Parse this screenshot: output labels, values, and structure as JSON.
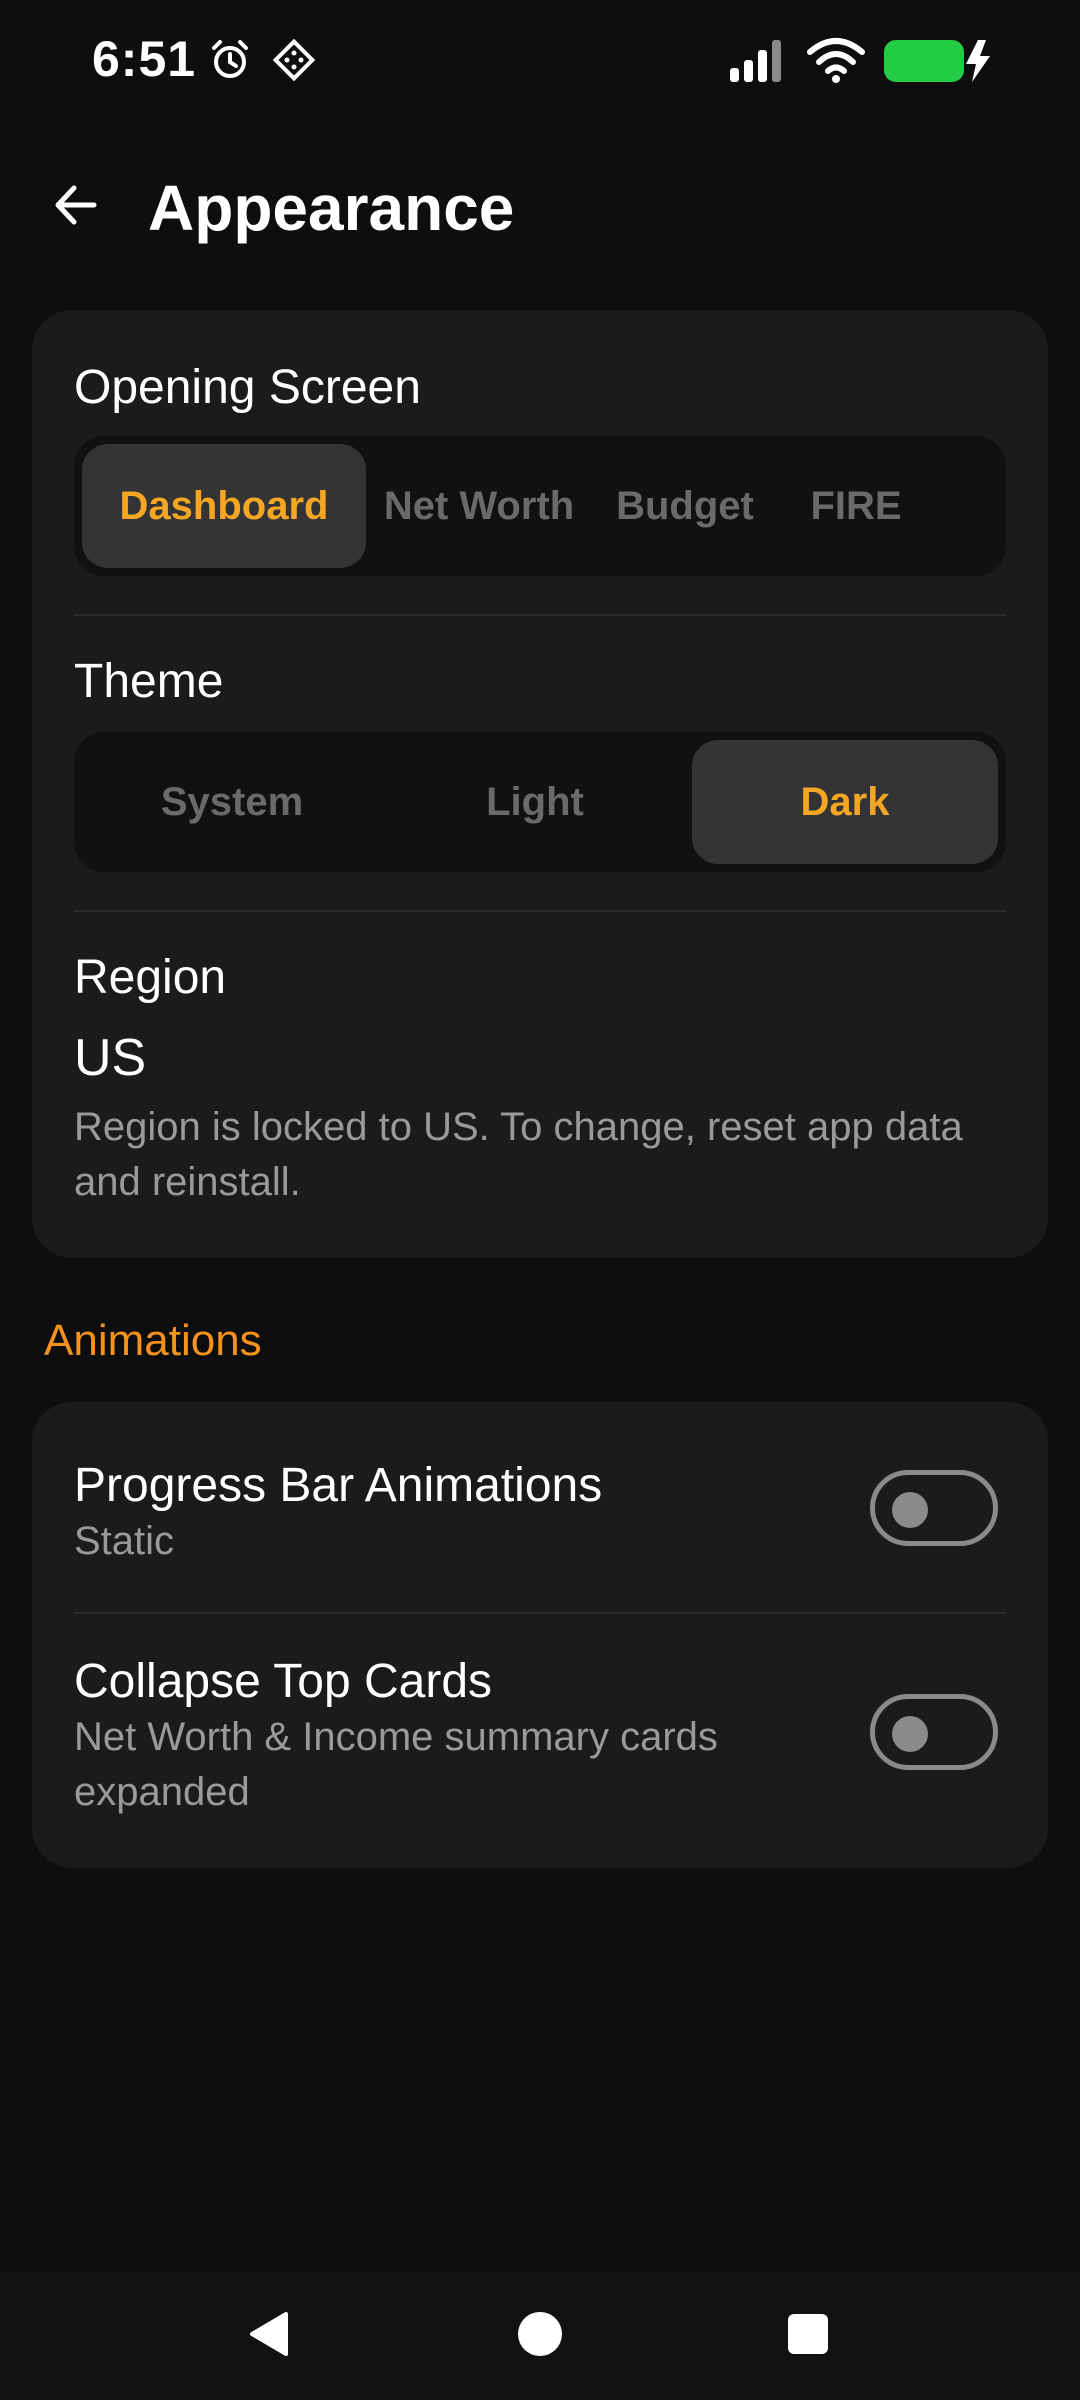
{
  "status_bar": {
    "time": "6:51",
    "icons": [
      "alarm-icon",
      "system-app-icon",
      "signal-icon",
      "wifi-icon",
      "battery-charging-icon"
    ],
    "battery_color": "#22cc44"
  },
  "header": {
    "title": "Appearance",
    "back_icon": "arrow-left-icon"
  },
  "appearance": {
    "opening_screen": {
      "label": "Opening Screen",
      "options": [
        "Dashboard",
        "Net Worth",
        "Budget",
        "FIRE"
      ],
      "selected": "Dashboard"
    },
    "theme": {
      "label": "Theme",
      "options": [
        "System",
        "Light",
        "Dark"
      ],
      "selected": "Dark"
    },
    "region": {
      "label": "Region",
      "value": "US",
      "note": "Region is locked to US. To change, reset app data and reinstall."
    }
  },
  "animations": {
    "heading": "Animations",
    "rows": [
      {
        "title": "Progress Bar Animations",
        "subtitle": "Static",
        "enabled": false
      },
      {
        "title": "Collapse Top Cards",
        "subtitle": "Net Worth & Income summary cards expanded",
        "enabled": false
      }
    ]
  },
  "nav_bar": {
    "icons": [
      "back-triangle-icon",
      "home-circle-icon",
      "recents-square-icon"
    ]
  },
  "colors": {
    "accent": "#f5a623",
    "heading_accent": "#f5921e",
    "background": "#0e0e0f",
    "card": "#1b1b1c"
  }
}
